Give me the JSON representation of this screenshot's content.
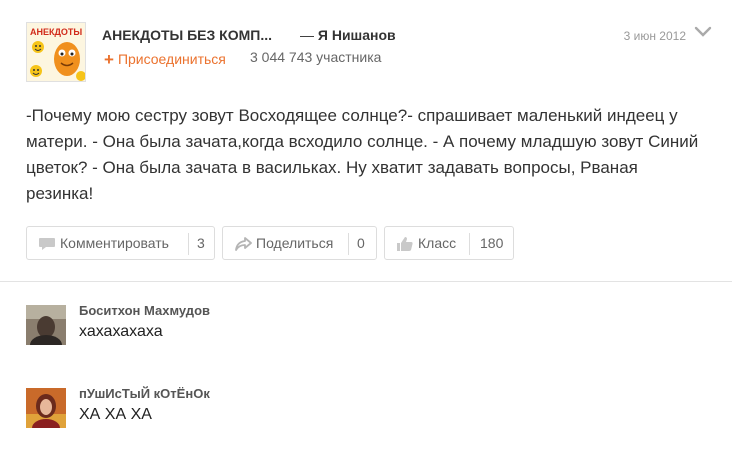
{
  "post": {
    "group_name": "АНЕКДОТЫ БЕЗ КОМП...",
    "author_separator": "—",
    "author_name": "Я Нишанов",
    "join_label": "Присоединиться",
    "members": "3 044 743 участника",
    "date": "3 июн 2012",
    "text": "-Почему мою сестру зовут Восходящее солнце?- спрашивает маленький индеец у матери. - Она была зачата,когда всходило солнце. - А почему младшую зовут Синий цветок? - Она была зачата в васильках. Ну хватит задавать вопросы, Рваная резинка!",
    "group_avatar_text": "АНЕКДОТЫ"
  },
  "actions": [
    {
      "label": "Комментировать",
      "count": "3",
      "icon": "comment-icon"
    },
    {
      "label": "Поделиться",
      "count": "0",
      "icon": "share-icon"
    },
    {
      "label": "Класс",
      "count": "180",
      "icon": "like-icon"
    }
  ],
  "comments": [
    {
      "author": "Боситхон Махмудов",
      "text": "хахахахаха"
    },
    {
      "author": "пУшИсТыЙ кОтЁнОк",
      "text": "ХА ХА ХА"
    }
  ],
  "colors": {
    "accent": "#eb722e",
    "text": "#333333",
    "muted": "#666666",
    "border": "#dddddd"
  }
}
